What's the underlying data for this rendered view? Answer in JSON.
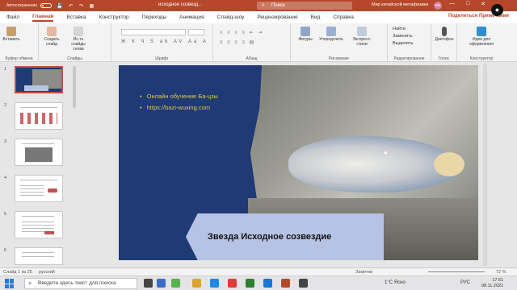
{
  "titlebar": {
    "autosave": "Автосохранение",
    "doc_title": "исходное созвезд...",
    "search": "Поиск",
    "user": "Мир китайской метафизики",
    "avatar": "МК",
    "min": "—",
    "max": "□",
    "close": "✕"
  },
  "menu": {
    "tabs": [
      "Файл",
      "Главная",
      "Вставка",
      "Конструктор",
      "Переходы",
      "Анимация",
      "Слайд-шоу",
      "Рецензирование",
      "Вид",
      "Справка"
    ],
    "active": 1,
    "share": "Поделиться",
    "record": "Примечания"
  },
  "ribbon": {
    "paste": "Вставить",
    "clipboard_group": "Буфер обмена",
    "new_slide": "Создать слайд",
    "reuse": "Ис-ть слайды снова",
    "slides_group": "Слайды",
    "font_group": "Шрифт",
    "paragraph_group": "Абзац",
    "shapes": "Фигуры",
    "arrange": "Упорядочить",
    "quick_styles": "Экспресс-стили",
    "drawing_group": "Рисование",
    "find": "Найти",
    "replace": "Заменить",
    "select": "Выделить",
    "editing_group": "Редактирование",
    "dictate": "Диктофон",
    "voice_group": "Голос",
    "designer": "Идеи для оформления",
    "designer_group": "Конструктор"
  },
  "thumbnails": {
    "numbers": [
      "1",
      "2",
      "3",
      "4",
      "5",
      "6"
    ],
    "selected": 0
  },
  "slide": {
    "bullets": [
      "Онлайн обучение Ба-цзы",
      "https://bazi-wuxing.com"
    ],
    "title": "Звезда Исходное созвездие"
  },
  "status": {
    "slide_count": "Слайд 1 из 25",
    "language": "русский",
    "notes": "Заметки",
    "zoom": "72 %"
  },
  "taskbar": {
    "search_placeholder": "Введите здесь текст для поиска",
    "weather": "1°C Ясно",
    "input_lang": "РУС",
    "time": "17:51",
    "date": "08.11.2021"
  },
  "colors": {
    "accent": "#b7472a",
    "slide_bg": "#1f3a74",
    "bullet_text": "#e0c84a",
    "title_box": "#b6c3e4"
  }
}
